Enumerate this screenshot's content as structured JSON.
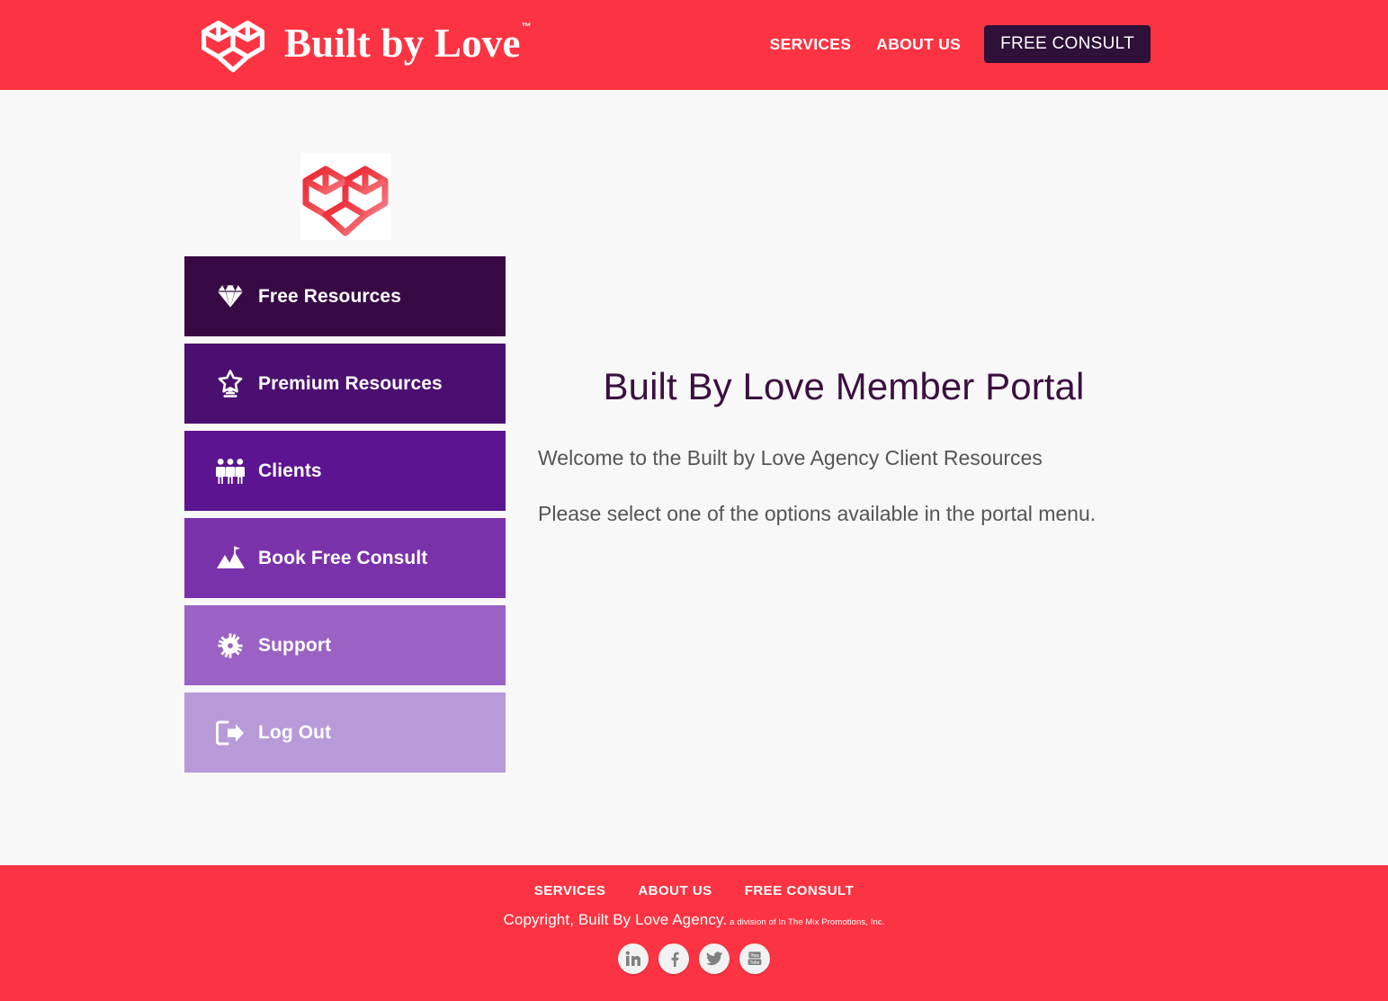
{
  "header": {
    "brand_name": "Built by Love",
    "brand_tm": "™",
    "brand_logo_icon": "heart-cube-logo-icon",
    "nav": [
      {
        "label": "SERVICES",
        "icon": ""
      },
      {
        "label": "ABOUT US",
        "icon": ""
      }
    ],
    "cta_label": "FREE CONSULT",
    "background_color": "#fc3342",
    "cta_color": "#2e1038"
  },
  "portal": {
    "logo_icon": "heart-cube-logo-icon",
    "menu": [
      {
        "label": "Free Resources",
        "icon": "diamond-icon",
        "color": "#370a45"
      },
      {
        "label": "Premium Resources",
        "icon": "star-trophy-icon",
        "color": "#4b0f70"
      },
      {
        "label": "Clients",
        "icon": "people-group-icon",
        "color": "#5c1490"
      },
      {
        "label": "Book Free Consult",
        "icon": "mountain-icon",
        "color": "#7a32ab"
      },
      {
        "label": "Support",
        "icon": "gear-icon",
        "color": "#9a62c4"
      },
      {
        "label": "Log Out",
        "icon": "sign-out-icon",
        "color": "#b89ad8"
      }
    ]
  },
  "main": {
    "title": "Built By Love Member Portal",
    "paragraph_1": "Welcome to the Built by Love Agency Client Resources",
    "paragraph_2": "Please select one of the options available in the portal menu.",
    "title_color": "#3b1040",
    "text_color": "#555555"
  },
  "footer": {
    "nav": [
      {
        "label": "SERVICES"
      },
      {
        "label": "ABOUT US"
      },
      {
        "label": "FREE CONSULT"
      }
    ],
    "copyright": "Copyright, Built By Love Agency.",
    "copyright_fine": "a division of In The Mix Promotions, Inc.",
    "background_color": "#fc3342",
    "social": [
      {
        "name": "linkedin",
        "icon": "linkedin-icon"
      },
      {
        "name": "facebook",
        "icon": "facebook-icon"
      },
      {
        "name": "twitter",
        "icon": "twitter-icon"
      },
      {
        "name": "youtube",
        "icon": "youtube-icon"
      }
    ]
  }
}
